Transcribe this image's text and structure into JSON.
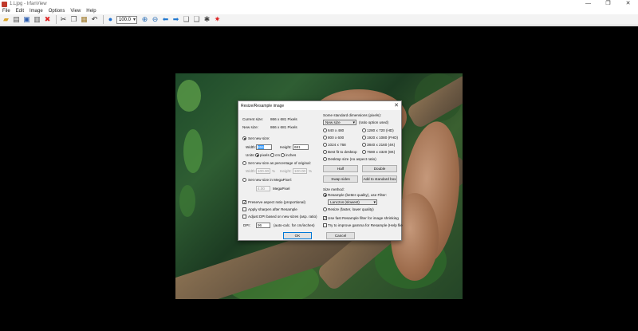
{
  "window": {
    "title": "1.Ljpg - IrfanView",
    "controls": [
      "—",
      "❐",
      "✕"
    ]
  },
  "menu": [
    "File",
    "Edit",
    "Image",
    "Options",
    "View",
    "Help"
  ],
  "toolbar": {
    "zoom_value": "100.0"
  },
  "dialog": {
    "title": "Resize/Resample image",
    "close": "✕",
    "current_size_label": "Current size:",
    "current_size_value": "866 x 681 Pixels",
    "new_size_label": "New size:",
    "new_size_value": "866 x 681 Pixels",
    "set_new_size": "Set new size:",
    "width_label": "Width:",
    "width_value": "866",
    "height_label": "Height:",
    "height_value": "681",
    "units_label": "Units:",
    "unit_pixels": "pixels",
    "unit_cm": "cm",
    "unit_inches": "inches",
    "set_percentage": "Set new size as percentage of original:",
    "pct_width_label": "Width:",
    "pct_width_value": "100.00",
    "pct_unit": "%",
    "pct_height_label": "Height:",
    "pct_height_value": "100.00",
    "set_megapixel": "Set new size in MegaPixel:",
    "megapixel_value": "4.00",
    "megapixel_unit": "MegaPixel",
    "preserve_aspect": "Preserve aspect ratio (proportional)",
    "apply_sharpen": "Apply sharpen after Resample",
    "adjust_dpi": "Adjust DPI based on new sizes (asp. ratio)",
    "dpi_label": "DPI:",
    "dpi_value": "96",
    "dpi_note": "(auto-calc. for cm/inches)",
    "ok": "OK",
    "cancel": "Cancel",
    "std_dims_title": "Some standard dimensions (pixels):",
    "std_select": "New size",
    "std_note": "(ratio option used)",
    "dims": [
      "640 x 480",
      "1280 x 720  (HD)",
      "800 x 600",
      "1920 x 1080 (FHD)",
      "1024 x 768",
      "3840 x 2160 (4K)",
      "Best fit to desktop",
      "7680 x 4320 (8K)"
    ],
    "desktop_size": "Desktop size (no aspect ratio)",
    "half": "Half",
    "double": "Double",
    "swap_sides": "Swap sides",
    "add_to_standard": "Add to standard box",
    "size_method_title": "Size method:",
    "resample": "Resample (better quality), use Filter:",
    "filter_value": "Lanczos (slowest)",
    "resize": "Resize (faster, lower quality)",
    "fast_resample": "Use fast Resample filter for image shrinking",
    "gamma": "Try to improve gamma for Resample (Help file"
  }
}
